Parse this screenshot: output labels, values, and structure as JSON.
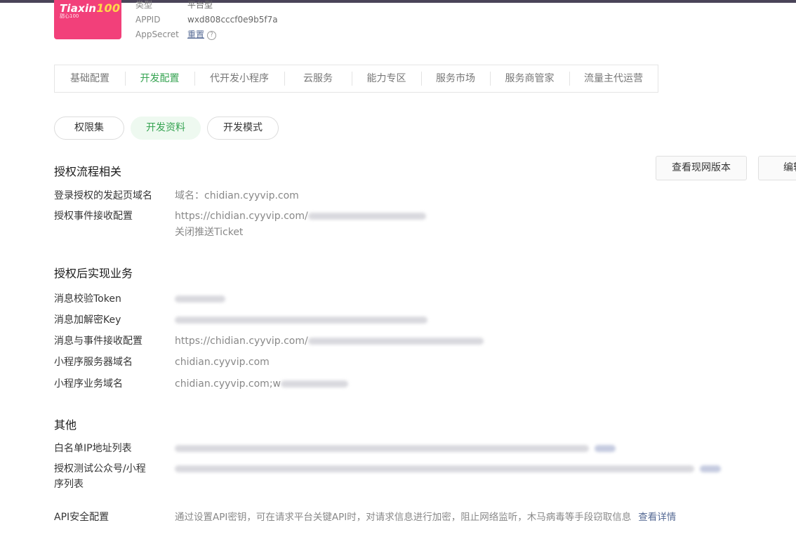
{
  "app": {
    "logo_text": "Tiaxin",
    "logo_num": "100",
    "logo_sub": "甜心100",
    "type_label": "类型",
    "type_value": "平台型",
    "appid_label": "APPID",
    "appid_value": "wxd808cccf0e9b5f7a",
    "secret_label": "AppSecret",
    "secret_action": "重置",
    "help_icon": "?"
  },
  "tabs": [
    {
      "label": "基础配置"
    },
    {
      "label": "开发配置"
    },
    {
      "label": "代开发小程序"
    },
    {
      "label": "云服务"
    },
    {
      "label": "能力专区"
    },
    {
      "label": "服务市场"
    },
    {
      "label": "服务商管家"
    },
    {
      "label": "流量主代运营"
    }
  ],
  "active_tab": "开发配置",
  "subtabs": [
    {
      "label": "权限集"
    },
    {
      "label": "开发资料"
    },
    {
      "label": "开发模式"
    }
  ],
  "active_subtab": "开发资料",
  "actions": {
    "view_current": "查看现网版本",
    "edit": "编辑"
  },
  "auth_flow": {
    "title": "授权流程相关",
    "login_domain_label": "登录授权的发起页域名",
    "login_domain_value": "域名：chidian.cyyvip.com",
    "event_label": "授权事件接收配置",
    "event_value": "https://chidian.cyyvip.com/",
    "event_link": "关闭推送Ticket"
  },
  "business": {
    "title": "授权后实现业务",
    "token_label": "消息校验Token",
    "key_label": "消息加解密Key",
    "msg_event_label": "消息与事件接收配置",
    "msg_event_value": "https://chidian.cyyvip.com/",
    "server_domain_label": "小程序服务器域名",
    "server_domain_value": "chidian.cyyvip.com",
    "biz_domain_label": "小程序业务域名",
    "biz_domain_value": "chidian.cyyvip.com;w"
  },
  "other": {
    "title": "其他",
    "whitelist_label": "白名单IP地址列表",
    "testlist_label_1": "授权测试公众号/小程",
    "testlist_label_2": "序列表",
    "api_label": "API安全配置",
    "api_desc": "通过设置API密钥，可在请求平台关键API时，对请求信息进行加密，阻止网络监听，木马病毒等手段窃取信息",
    "api_link": "查看详情"
  },
  "colors": {
    "accent_green": "#35a351",
    "link_blue": "#576b95",
    "logo_pink": "#f2407a"
  }
}
